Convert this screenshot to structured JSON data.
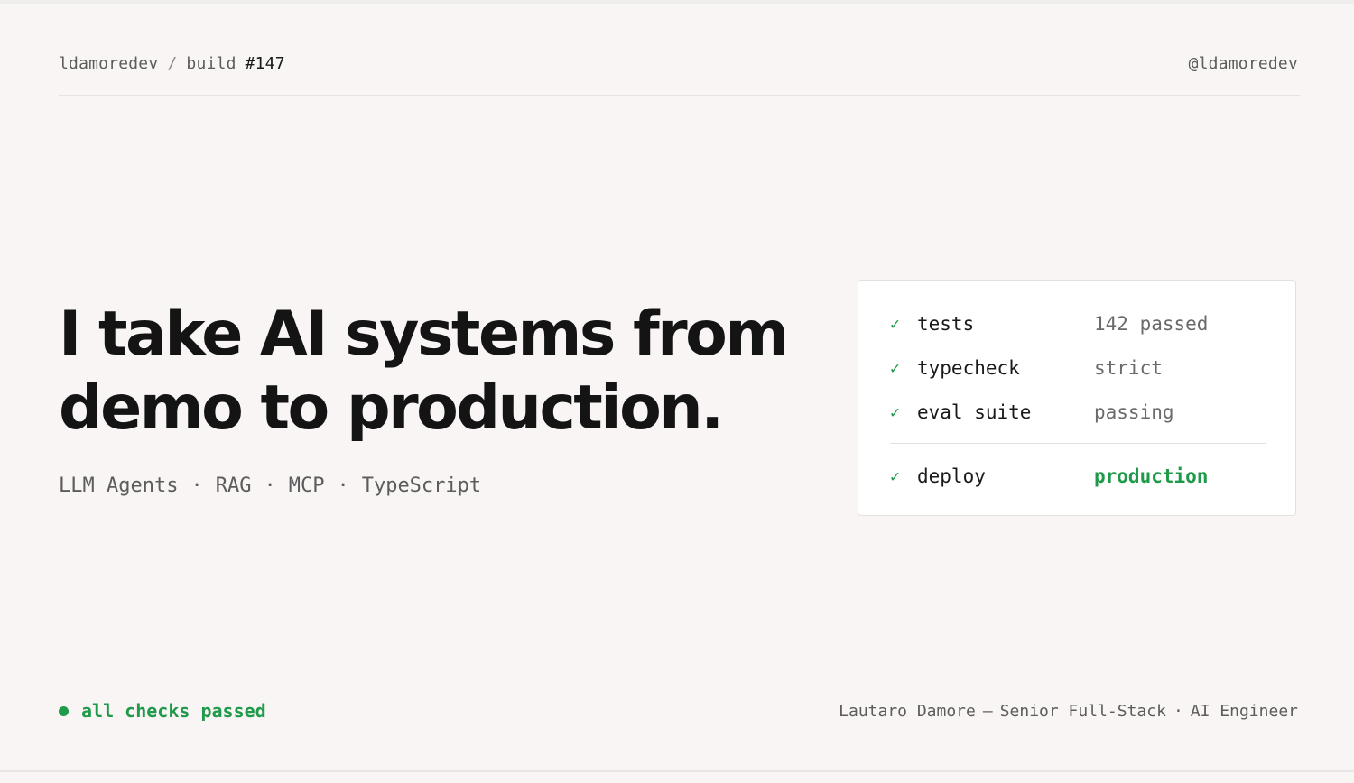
{
  "header": {
    "owner": "ldamoredev",
    "separator": "/",
    "section": "build",
    "build_number": "#147",
    "handle": "@ldamoredev"
  },
  "hero": {
    "line1": "I take AI systems from",
    "line2": "demo to production."
  },
  "tags": {
    "separator": "·",
    "items": [
      "LLM Agents",
      "RAG",
      "MCP",
      "TypeScript"
    ]
  },
  "checks": {
    "icon": "check-icon",
    "items": [
      {
        "label": "tests",
        "value": "142 passed",
        "status": "neutral"
      },
      {
        "label": "typecheck",
        "value": "strict",
        "status": "neutral"
      },
      {
        "label": "eval suite",
        "value": "passing",
        "status": "neutral"
      },
      {
        "label": "deploy",
        "value": "production",
        "status": "success"
      }
    ]
  },
  "status": {
    "text": "all checks passed",
    "color": "#1f9a4a"
  },
  "footer": {
    "name": "Lautaro Damore",
    "dash": "—",
    "role": "Senior Full-Stack",
    "dot": "·",
    "title": "AI Engineer"
  },
  "colors": {
    "background": "#f8f5f4",
    "accent": "#1f9a4a",
    "text": "#141414",
    "muted": "#5c5c5c"
  }
}
